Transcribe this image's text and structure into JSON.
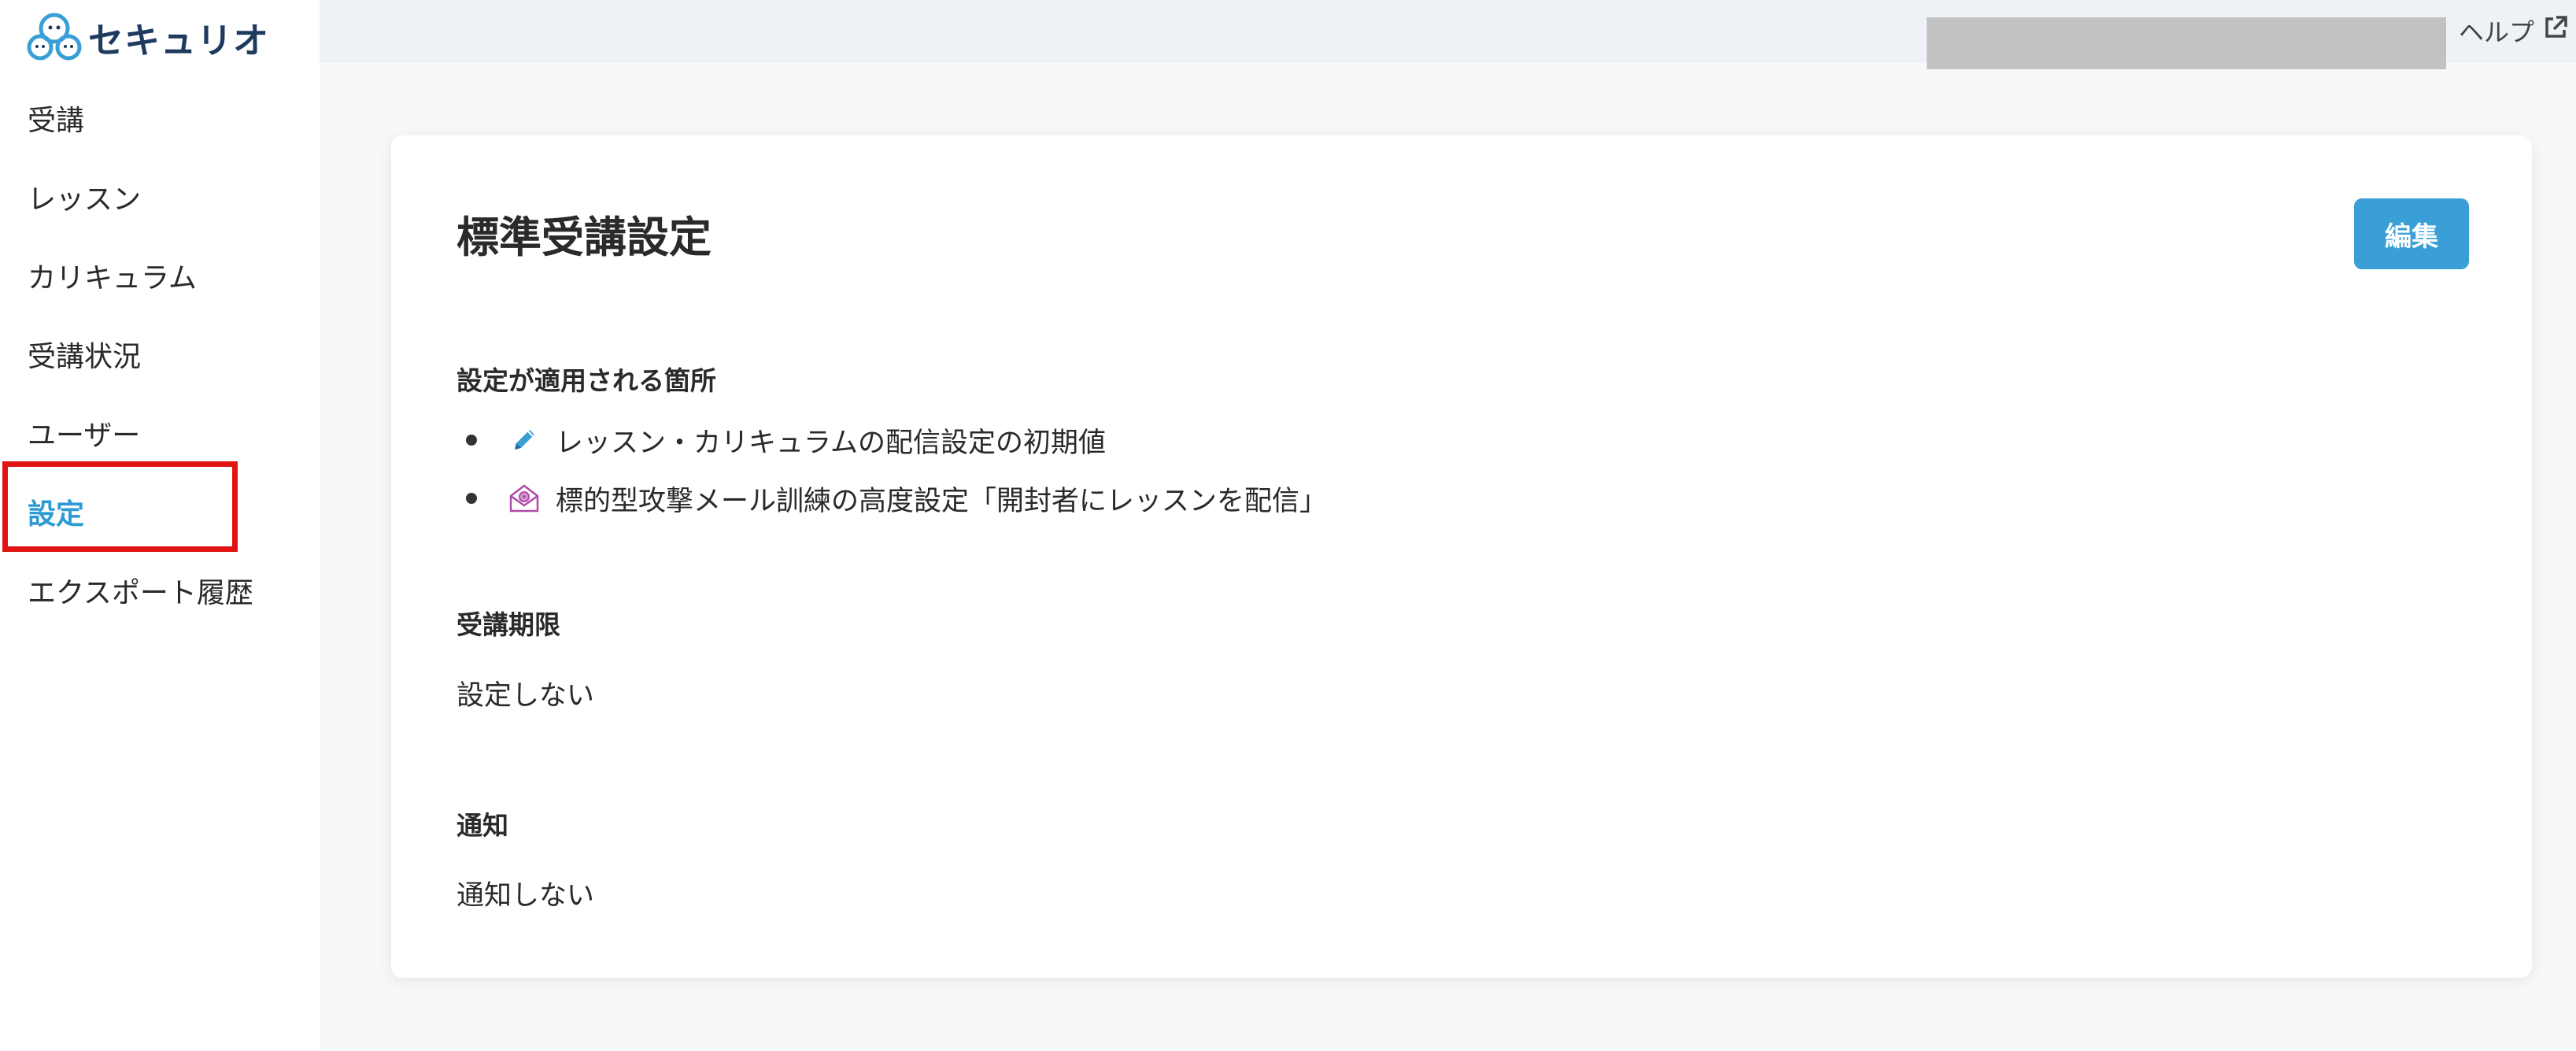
{
  "app": {
    "logo_text": "セキュリオ"
  },
  "sidebar": {
    "items": [
      {
        "label": "受講"
      },
      {
        "label": "レッスン"
      },
      {
        "label": "カリキュラム"
      },
      {
        "label": "受講状況"
      },
      {
        "label": "ユーザー"
      },
      {
        "label": "設定",
        "active": true
      },
      {
        "label": "エクスポート履歴"
      }
    ]
  },
  "header": {
    "help_label": "ヘルプ"
  },
  "main": {
    "title": "標準受講設定",
    "edit_label": "編集",
    "applies_to": {
      "label": "設定が適用される箇所",
      "items": [
        {
          "icon": "pencil-icon",
          "text": "レッスン・カリキュラムの配信設定の初期値"
        },
        {
          "icon": "phishing-mail-icon",
          "text": "標的型攻撃メール訓練の高度設定「開封者にレッスンを配信」"
        }
      ]
    },
    "deadline": {
      "label": "受講期限",
      "value": "設定しない"
    },
    "notification": {
      "label": "通知",
      "value": "通知しない"
    }
  },
  "colors": {
    "accent": "#3a9fd6",
    "active_nav": "#2d9bd2",
    "highlight": "#e11414",
    "brand_dark": "#1e3a5f"
  }
}
